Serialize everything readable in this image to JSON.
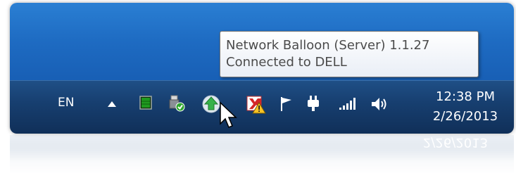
{
  "tooltip": {
    "line1": "Network Balloon (Server) 1.1.27",
    "line2": "Connected to DELL"
  },
  "taskbar": {
    "language": "EN",
    "clock_time": "12:38 PM",
    "clock_date": "2/26/2013"
  },
  "icons": [
    "show-hidden-icons-arrow",
    "green-monitor-icon",
    "usb-safely-remove-icon",
    "network-balloon-icon",
    "security-alert-icon",
    "action-center-flag-icon",
    "power-plug-icon",
    "signal-bars-icon",
    "speaker-volume-icon"
  ],
  "colors": {
    "desktop_blue": "#1e6bc2",
    "taskbar_blue": "#173f70",
    "tooltip_text": "#4b4b4b"
  }
}
